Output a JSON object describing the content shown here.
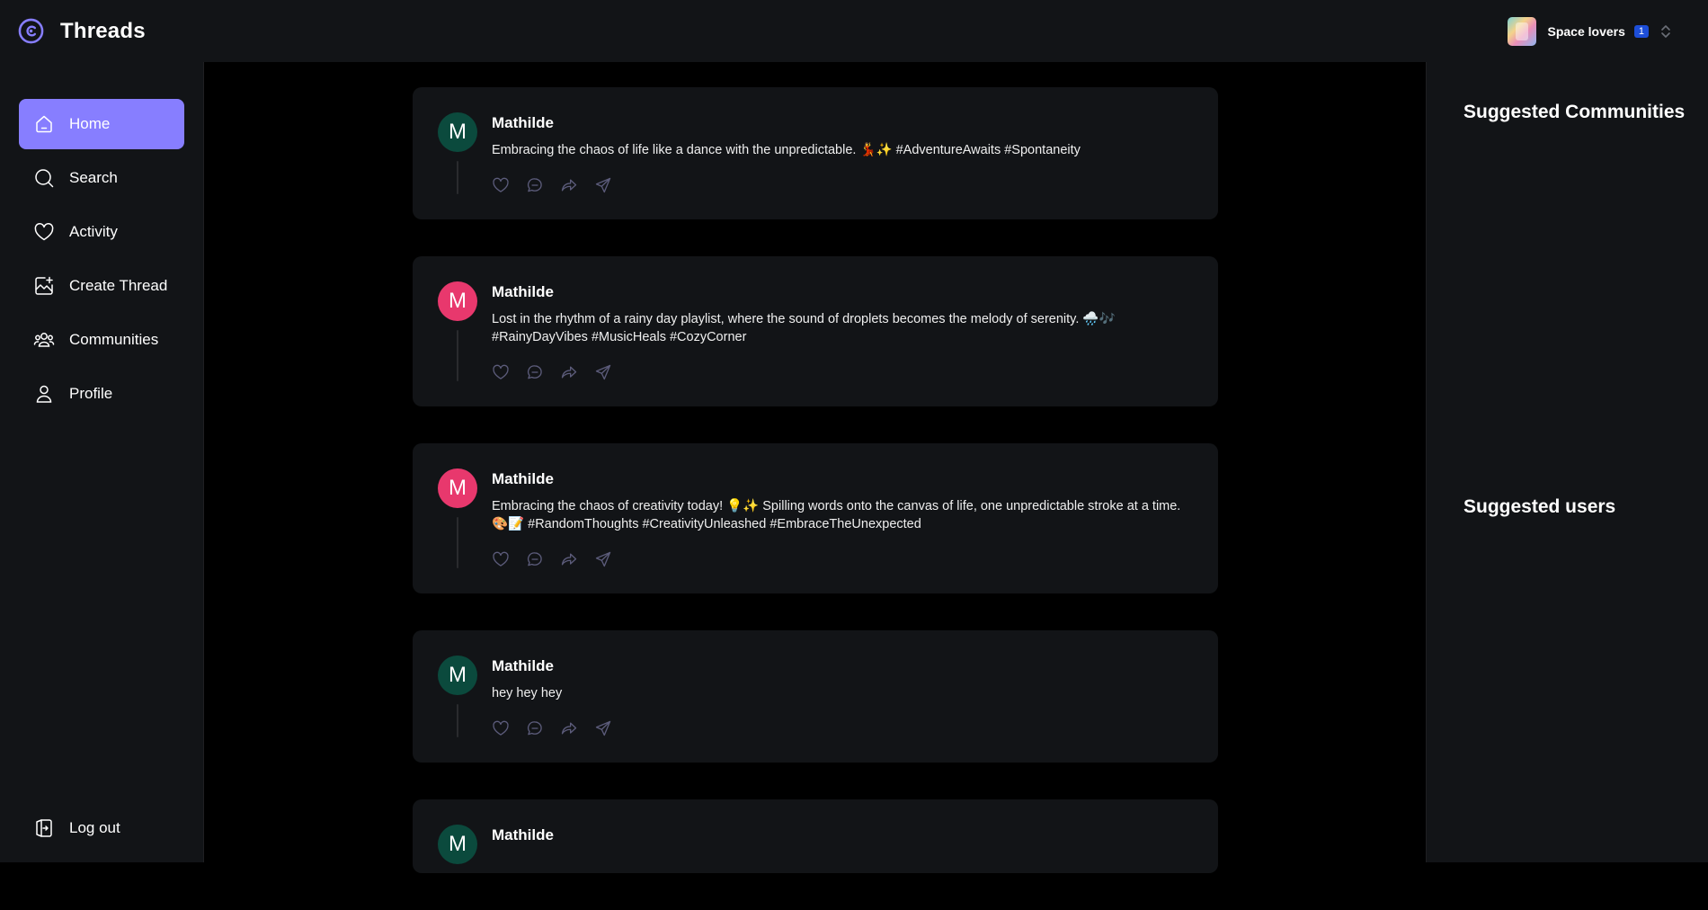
{
  "app": {
    "title": "Threads"
  },
  "org": {
    "name": "Space lovers",
    "badge": "1"
  },
  "nav": {
    "items": [
      {
        "label": "Home",
        "icon": "home-icon",
        "active": true
      },
      {
        "label": "Search",
        "icon": "search-icon"
      },
      {
        "label": "Activity",
        "icon": "heart-icon"
      },
      {
        "label": "Create Thread",
        "icon": "create-icon"
      },
      {
        "label": "Communities",
        "icon": "communities-icon"
      },
      {
        "label": "Profile",
        "icon": "user-icon"
      }
    ],
    "logout": "Log out"
  },
  "right": {
    "communities_title": "Suggested Communities",
    "users_title": "Suggested users"
  },
  "posts": [
    {
      "author": "Mathilde",
      "initial": "M",
      "avatar_color": "#0b4a3d",
      "text": "Embracing the chaos of life like a dance with the unpredictable. 💃✨ #AdventureAwaits #Spontaneity"
    },
    {
      "author": "Mathilde",
      "initial": "M",
      "avatar_color": "#e8386d",
      "text": "Lost in the rhythm of a rainy day playlist, where the sound of droplets becomes the melody of serenity. 🌧️🎶 #RainyDayVibes #MusicHeals #CozyCorner"
    },
    {
      "author": "Mathilde",
      "initial": "M",
      "avatar_color": "#e8386d",
      "text": "Embracing the chaos of creativity today! 💡✨ Spilling words onto the canvas of life, one unpredictable stroke at a time. 🎨📝 #RandomThoughts #CreativityUnleashed #EmbraceTheUnexpected"
    },
    {
      "author": "Mathilde",
      "initial": "M",
      "avatar_color": "#0b4a3d",
      "text": "hey hey hey"
    },
    {
      "author": "Mathilde",
      "initial": "M",
      "avatar_color": "#0b4a3d",
      "text": ""
    }
  ],
  "colors": {
    "accent": "#877eff",
    "panel": "#121417",
    "background": "#000000"
  }
}
